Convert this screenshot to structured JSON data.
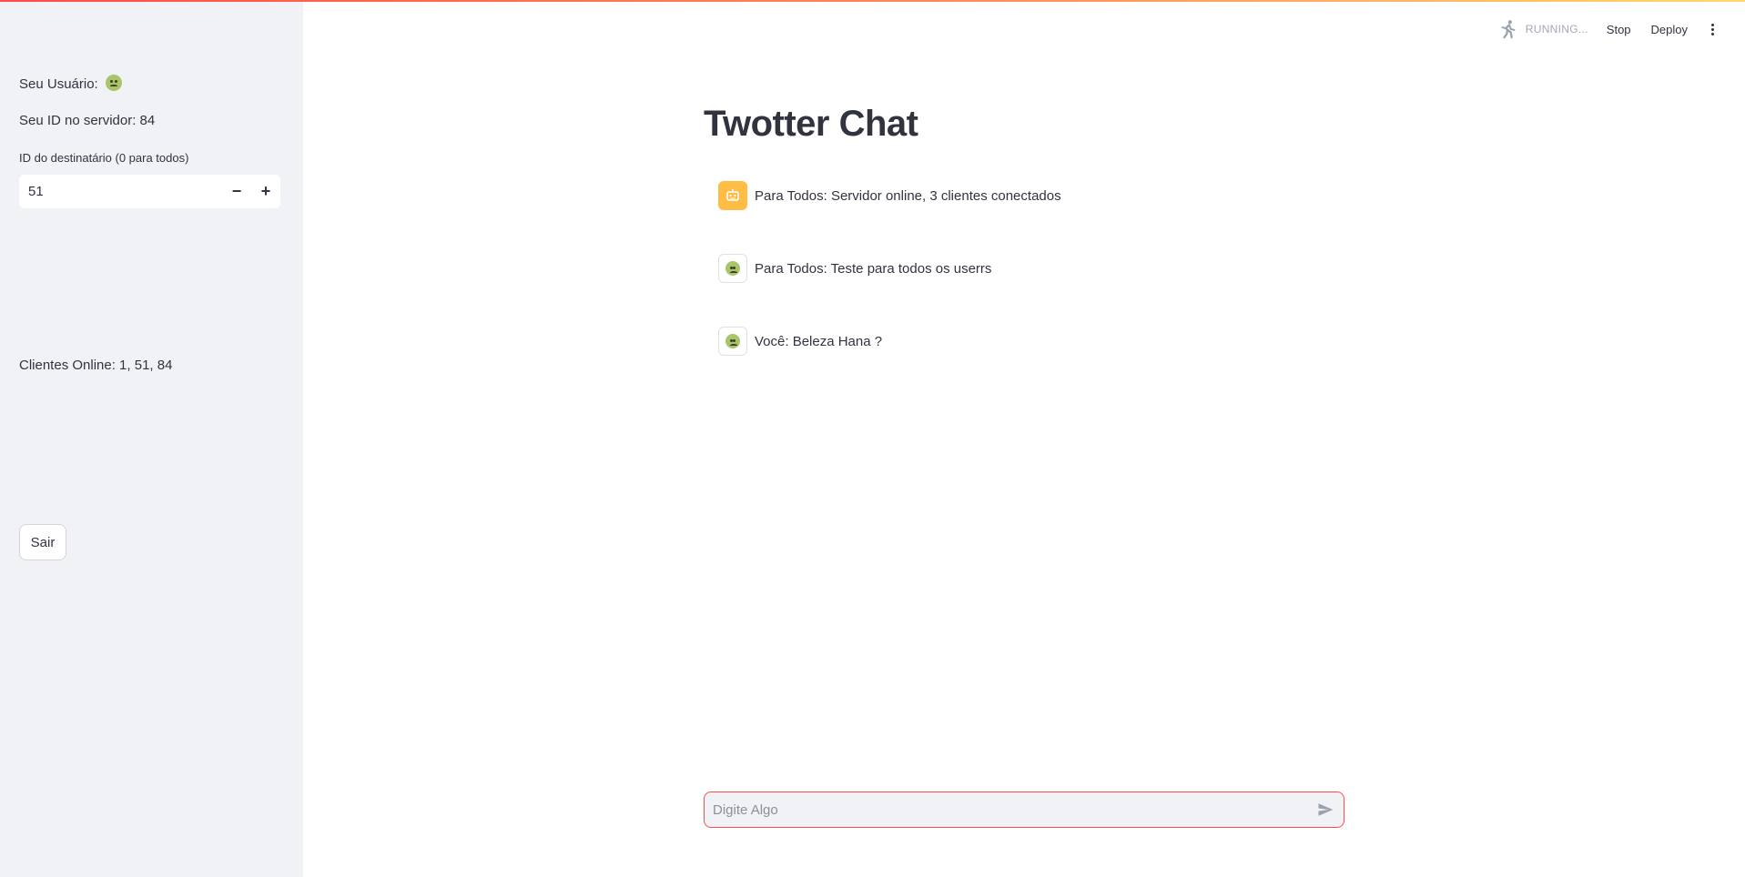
{
  "sidebar": {
    "user_label": "Seu Usuário:",
    "server_id": "Seu ID no servidor: 84",
    "recipient_label": "ID do destinatário (0 para todos)",
    "recipient_value": "51",
    "online_clients": "Clientes Online: 1, 51, 84",
    "exit_button": "Sair"
  },
  "header": {
    "status": "RUNNING...",
    "stop": "Stop",
    "deploy": "Deploy"
  },
  "main": {
    "title": "Twotter Chat",
    "messages": [
      {
        "avatar": "robot-icon",
        "text": "Para Todos: Servidor online, 3 clientes conectados"
      },
      {
        "avatar": "nauseated-face-emoji",
        "text": "Para Todos: Teste para todos os userrs"
      },
      {
        "avatar": "nauseated-face-emoji",
        "text": "Você: Beleza Hana ?"
      }
    ]
  },
  "chat_input": {
    "placeholder": "Digite Algo"
  },
  "colors": {
    "accent": "#ff4b4b",
    "bot_avatar": "#ffbd45",
    "sidebar_bg": "#f0f2f6"
  }
}
